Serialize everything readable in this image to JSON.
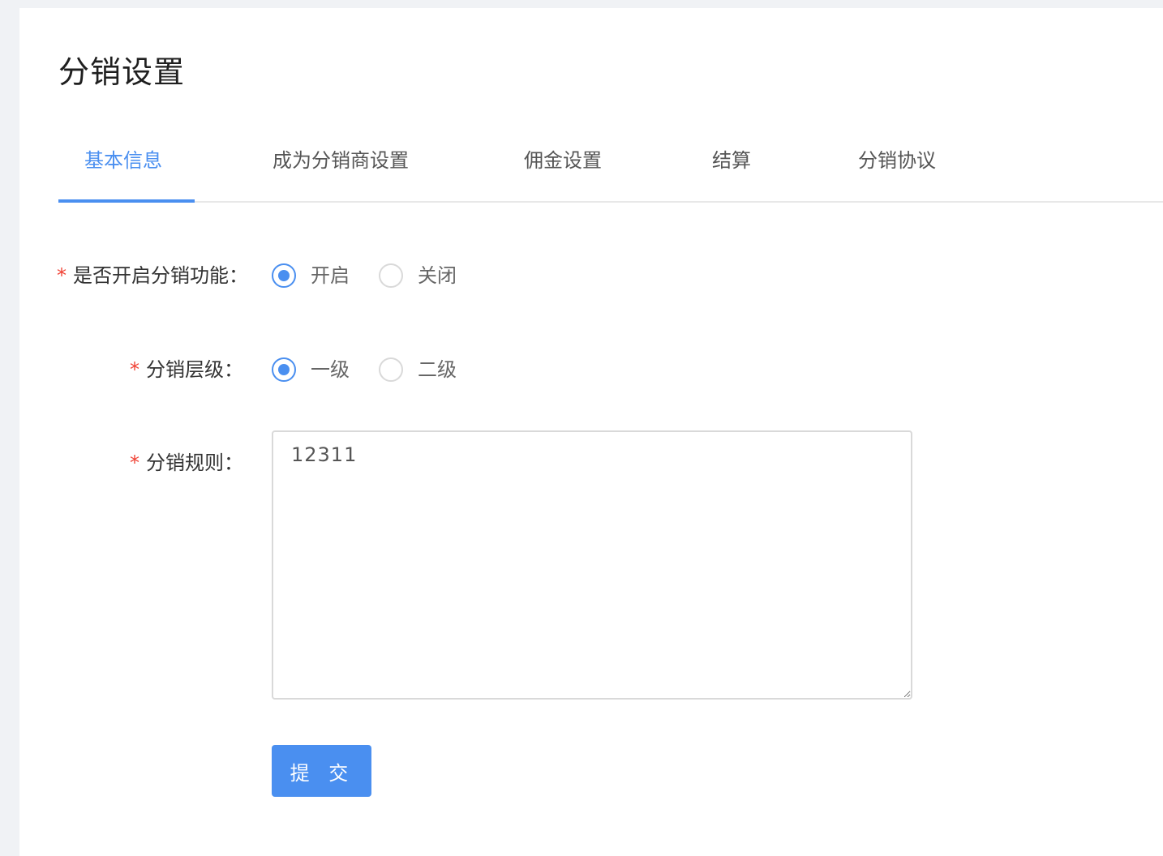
{
  "page": {
    "title": "分销设置"
  },
  "tabs": [
    {
      "label": "基本信息",
      "active": true
    },
    {
      "label": "成为分销商设置",
      "active": false
    },
    {
      "label": "佣金设置",
      "active": false
    },
    {
      "label": "结算",
      "active": false
    },
    {
      "label": "分销协议",
      "active": false
    }
  ],
  "form": {
    "required_mark": "*",
    "enable": {
      "label": "是否开启分销功能：",
      "options": [
        {
          "label": "开启",
          "checked": true
        },
        {
          "label": "关闭",
          "checked": false
        }
      ]
    },
    "level": {
      "label": "分销层级：",
      "options": [
        {
          "label": "一级",
          "checked": true
        },
        {
          "label": "二级",
          "checked": false
        }
      ]
    },
    "rules": {
      "label": "分销规则：",
      "value": "12311"
    },
    "submit_label": "提 交"
  },
  "colors": {
    "accent": "#4a8ff0",
    "required": "#f04134",
    "background": "#f0f2f5"
  }
}
